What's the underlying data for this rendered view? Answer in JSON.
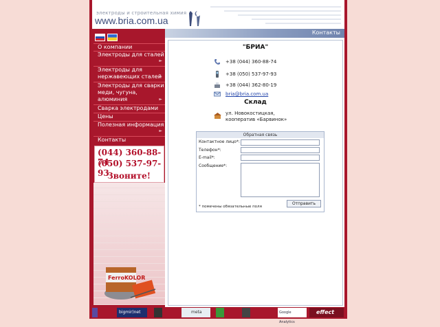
{
  "header": {
    "tagline": "электроды и строительная химия",
    "site_url": "www.bria.com.ua"
  },
  "title_bar": {
    "label": "Контакты"
  },
  "nav": [
    {
      "label": "О компании"
    },
    {
      "label": "Электроды для сталей"
    },
    {
      "label": "Электроды для нержавеющих сталей"
    },
    {
      "label": "Электроды для сварки меди, чугуна, алюминия"
    },
    {
      "label": "Сварка электродами"
    },
    {
      "label": "Цены"
    },
    {
      "label": "Полезная информация"
    },
    {
      "label": "Контакты"
    }
  ],
  "promo": {
    "phone1": "(044) 360-88-74",
    "phone2": "(050) 537-97-93",
    "call": "Звоните!",
    "product_brand": "FerroKOLOR"
  },
  "main": {
    "company": "\"БРИА\"",
    "contacts": [
      {
        "text": "+38 (044) 360-88-74"
      },
      {
        "text": "+38 (050) 537-97-93"
      },
      {
        "text": "+38 (044) 362-80-19"
      },
      {
        "text": "bria@bria.com.ua"
      }
    ],
    "warehouse_title": "Склад",
    "warehouse_address": "ул. Новокостицкая, кооператив «Барвинок»"
  },
  "form": {
    "title": "Обратная связь",
    "contact_person": "Контактное лицо*:",
    "phone": "Телефон*:",
    "email": "E-mail*:",
    "message": "Сообщение*:",
    "submit": "Отправить",
    "required_note": "* помечены обязательные поля"
  },
  "counters": {
    "c1": "bigmir)net",
    "c2": "meta",
    "c3": "Google Analytics",
    "c4": "effect"
  },
  "colors": {
    "brand": "#a8172c",
    "accent": "#3c4c7a"
  }
}
